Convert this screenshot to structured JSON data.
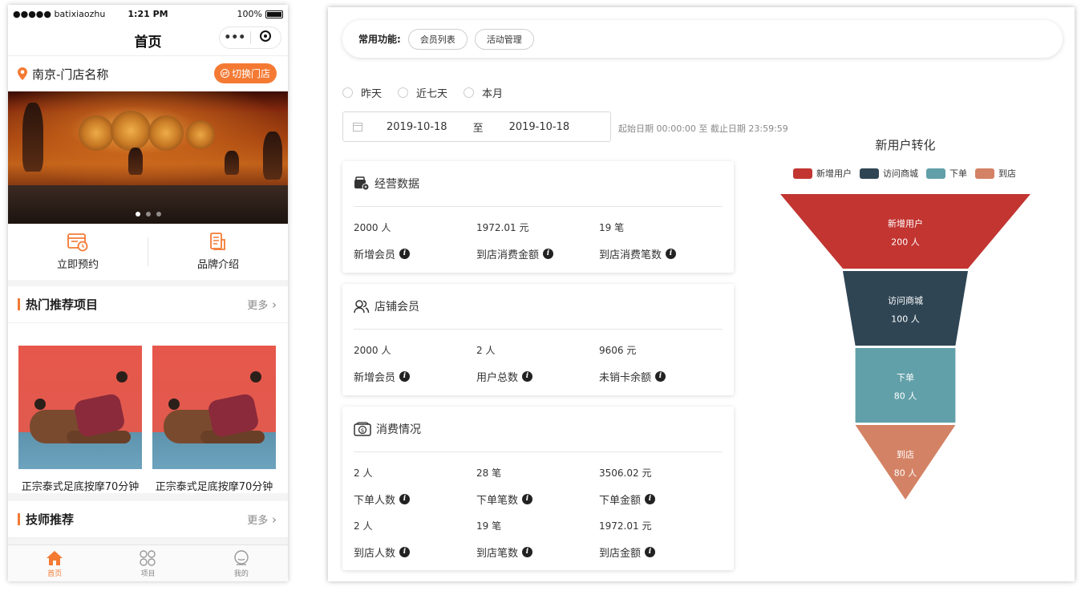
{
  "phone": {
    "status": {
      "carrier": "●●●●● batixiaozhu",
      "time": "1:21 PM",
      "battery": "100%"
    },
    "nav_title": "首页",
    "capsule_dots": "•••",
    "store": {
      "name": "南京-门店名称",
      "switch_label": "切换门店"
    },
    "quick_actions": [
      {
        "label": "立即预约",
        "icon": "booking-icon"
      },
      {
        "label": "品牌介绍",
        "icon": "brand-intro-icon"
      }
    ],
    "hot": {
      "title": "热门推荐项目",
      "more": "更多"
    },
    "products": [
      {
        "name": "正宗泰式足底按摩70分钟"
      },
      {
        "name": "正宗泰式足底按摩70分钟"
      }
    ],
    "tech": {
      "title": "技师推荐",
      "more": "更多"
    },
    "tabs": [
      {
        "label": "首页",
        "icon": "home-icon"
      },
      {
        "label": "项目",
        "icon": "projects-icon"
      },
      {
        "label": "我的",
        "icon": "profile-icon"
      }
    ],
    "accent": "#f47a34"
  },
  "dashboard": {
    "func_label": "常用功能:",
    "chips": [
      "会员列表",
      "活动管理"
    ],
    "radios": [
      "昨天",
      "近七天",
      "本月"
    ],
    "date_start": "2019-10-18",
    "date_sep": "至",
    "date_end": "2019-10-18",
    "range_hint": "起始日期 00:00:00 至 截止日期 23:59:59",
    "cards": [
      {
        "title": "经营数据",
        "rows": [
          [
            {
              "value": "2000 人",
              "label": "新增会员"
            },
            {
              "value": "1972.01 元",
              "label": "到店消费金额"
            },
            {
              "value": "19 笔",
              "label": "到店消费笔数"
            }
          ]
        ]
      },
      {
        "title": "店铺会员",
        "rows": [
          [
            {
              "value": "2000 人",
              "label": "新增会员"
            },
            {
              "value": "2 人",
              "label": "用户总数"
            },
            {
              "value": "9606 元",
              "label": "未销卡余额"
            }
          ]
        ]
      },
      {
        "title": "消费情况",
        "rows": [
          [
            {
              "value": "2 人",
              "label": "下单人数"
            },
            {
              "value": "28 笔",
              "label": "下单笔数"
            },
            {
              "value": "3506.02 元",
              "label": "下单金额"
            }
          ],
          [
            {
              "value": "2 人",
              "label": "到店人数"
            },
            {
              "value": "19 笔",
              "label": "到店笔数"
            },
            {
              "value": "1972.01 元",
              "label": "到店金额"
            }
          ]
        ]
      }
    ]
  },
  "chart_data": {
    "type": "funnel",
    "title": "新用户转化",
    "legend_position": "top",
    "stages": [
      {
        "name": "新增用户",
        "value": 200,
        "value_label": "200 人",
        "color": "#c23531"
      },
      {
        "name": "访问商城",
        "value": 100,
        "value_label": "100 人",
        "color": "#2f4554"
      },
      {
        "name": "下单",
        "value": 80,
        "value_label": "80 人",
        "color": "#61a0a8"
      },
      {
        "name": "到店",
        "value": 80,
        "value_label": "80 人",
        "color": "#d48265"
      }
    ]
  }
}
